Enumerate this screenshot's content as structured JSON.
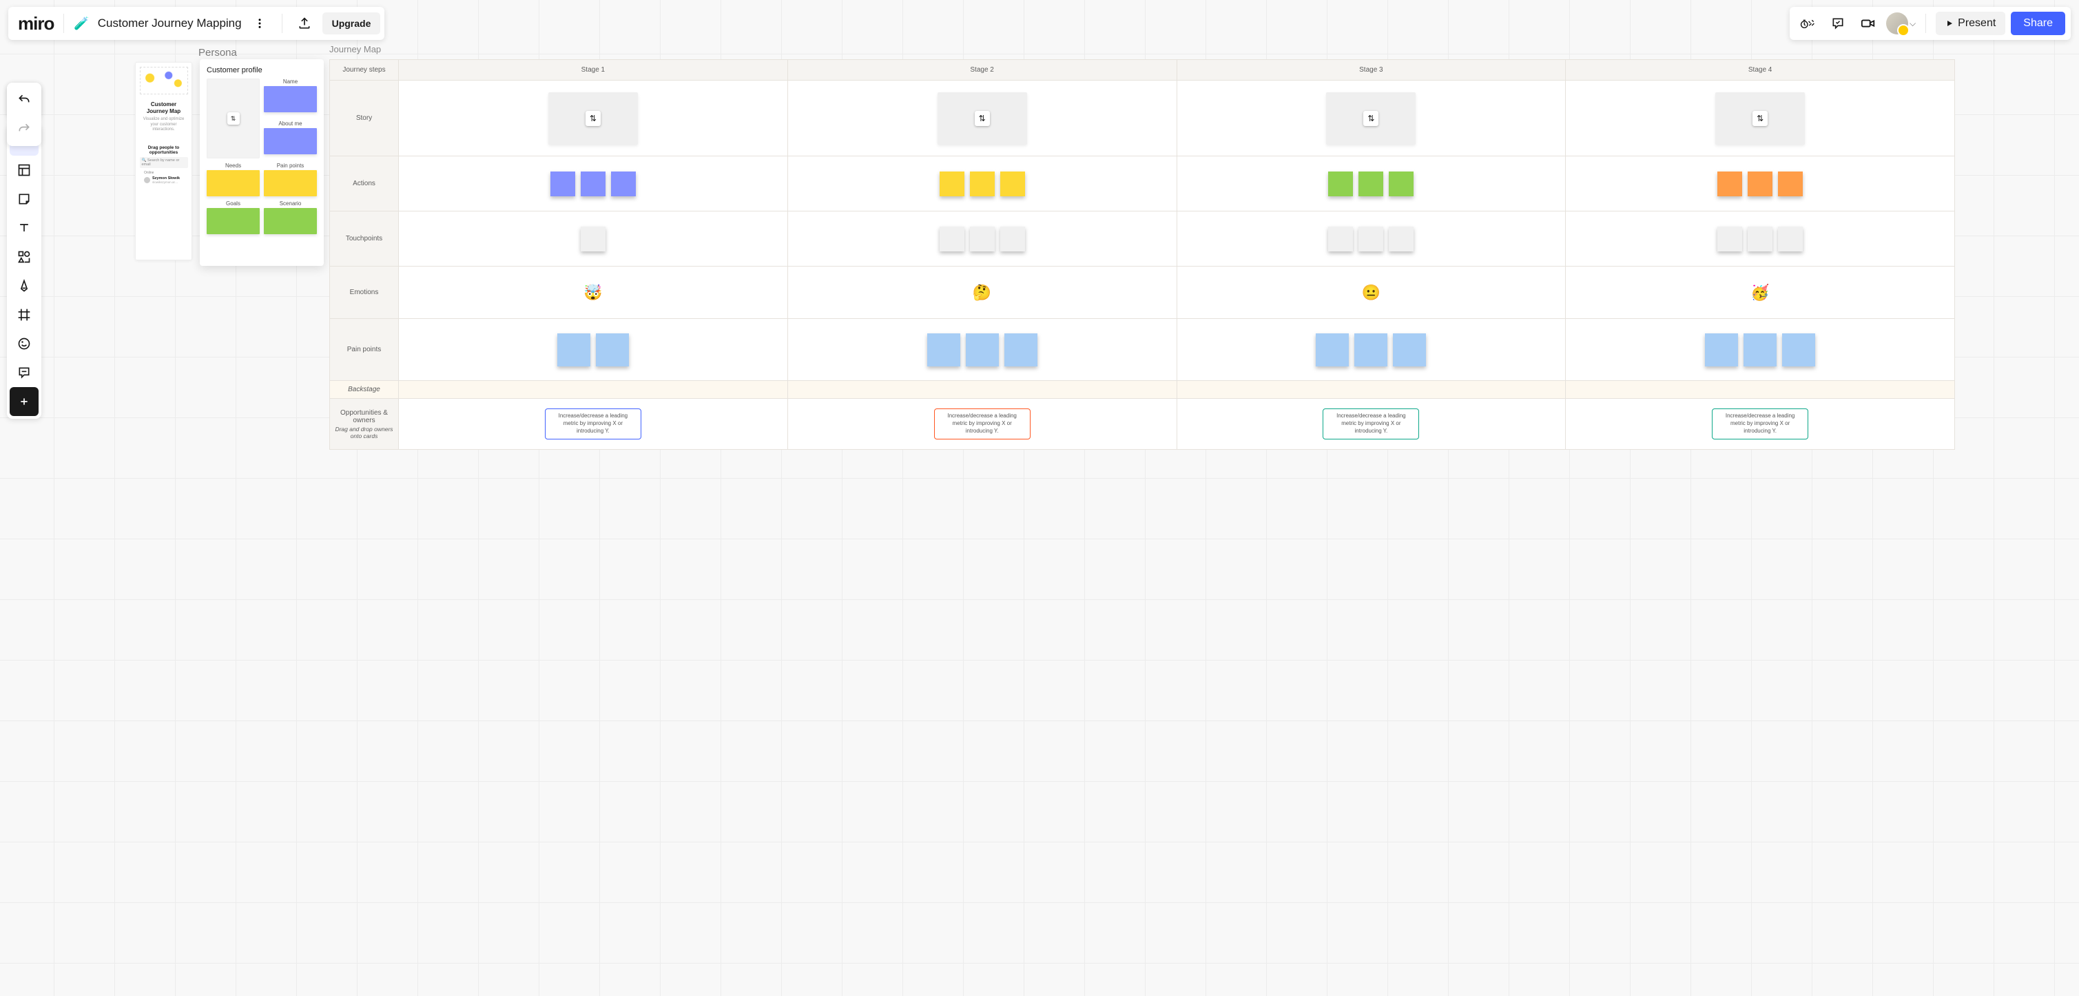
{
  "header": {
    "logo": "miro",
    "board_title": "Customer Journey Mapping",
    "upgrade": "Upgrade",
    "present": "Present",
    "share": "Share"
  },
  "sections": {
    "persona": "Persona",
    "journey": "Journey Map"
  },
  "persona_preview": {
    "title": "Customer Journey Map",
    "subtitle": "Visualize and optimize your customer interactions.",
    "drag_title": "Drag people to opportunities",
    "search_placeholder": "Search by name or email",
    "online_label": "Online",
    "user_name": "Szymon Słowik",
    "user_email": "slowikszymon.ar…"
  },
  "profile": {
    "title": "Customer profile",
    "labels": {
      "name": "Name",
      "about": "About me",
      "needs": "Needs",
      "pain": "Pain points",
      "goals": "Goals",
      "scenario": "Scenario"
    }
  },
  "journey": {
    "header": "Journey steps",
    "stages": [
      "Stage 1",
      "Stage 2",
      "Stage 3",
      "Stage 4"
    ],
    "rows": {
      "story": "Story",
      "actions": "Actions",
      "touch": "Touchpoints",
      "emotions": "Emotions",
      "pain": "Pain points",
      "backstage": "Backstage",
      "opportunities": "Opportunities & owners",
      "opportunities_sub": "Drag and drop owners onto cards"
    },
    "action_colors": [
      "#8591ff",
      "#fdd835",
      "#8fd14f",
      "#ff9d48"
    ],
    "pain_color": "#a7cdf5",
    "emotions": [
      "🤯",
      "🤔",
      "😐",
      "🥳"
    ],
    "opp_text": "Increase/decrease a leading metric by improving X or introducing Y.",
    "opp_border": [
      "#4262ff",
      "#ff5722",
      "#0ca789",
      "#0ca789"
    ]
  }
}
